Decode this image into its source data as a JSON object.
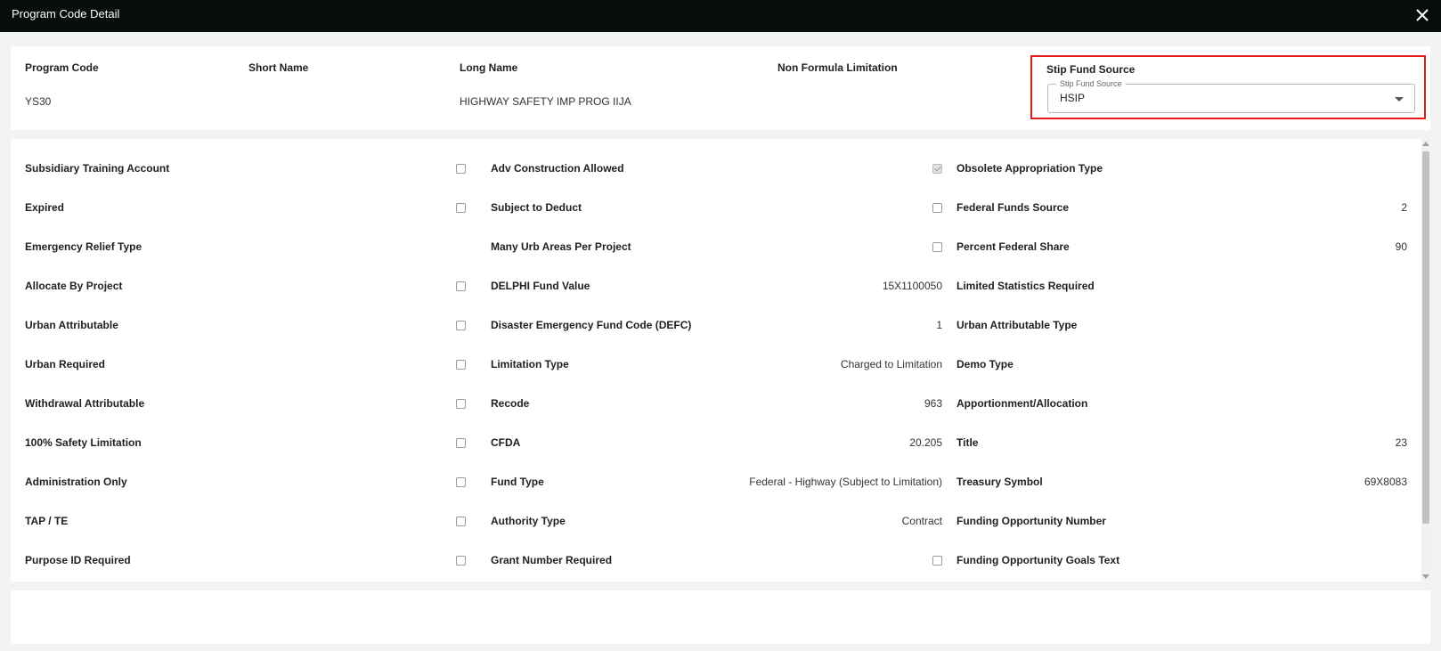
{
  "window": {
    "title": "Program Code Detail",
    "close_icon": "close-icon"
  },
  "header": {
    "program_code_label": "Program Code",
    "program_code_value": "YS30",
    "short_name_label": "Short Name",
    "short_name_value": "",
    "long_name_label": "Long Name",
    "long_name_value": "HIGHWAY SAFETY IMP PROG IIJA",
    "non_formula_label": "Non Formula Limitation",
    "non_formula_value": "",
    "stip_fund_source_label": "Stip Fund Source",
    "stip_fund_source_field_label": "Stip Fund Source",
    "stip_fund_source_value": "HSIP",
    "highlight_color": "#e31b1b"
  },
  "detail": {
    "rows": [
      {
        "c1": {
          "label": "Subsidiary Training Account",
          "checkbox": false
        },
        "c2": {
          "label": "Adv Construction Allowed",
          "checkbox": true
        },
        "c3": {
          "label": "Obsolete Appropriation Type",
          "value": ""
        }
      },
      {
        "c1": {
          "label": "Expired",
          "checkbox": false
        },
        "c2": {
          "label": "Subject to Deduct",
          "checkbox": false
        },
        "c3": {
          "label": "Federal Funds Source",
          "value": "2"
        }
      },
      {
        "c1": {
          "label": "Emergency Relief Type",
          "value": ""
        },
        "c2": {
          "label": "Many Urb Areas Per Project",
          "checkbox": false
        },
        "c3": {
          "label": "Percent Federal Share",
          "value": "90"
        }
      },
      {
        "c1": {
          "label": "Allocate By Project",
          "checkbox": false
        },
        "c2": {
          "label": "DELPHI Fund Value",
          "value": "15X1100050"
        },
        "c3": {
          "label": "Limited Statistics Required",
          "value": ""
        }
      },
      {
        "c1": {
          "label": "Urban Attributable",
          "checkbox": false
        },
        "c2": {
          "label": "Disaster Emergency Fund Code (DEFC)",
          "value": "1"
        },
        "c3": {
          "label": "Urban Attributable Type",
          "value": ""
        }
      },
      {
        "c1": {
          "label": "Urban Required",
          "checkbox": false
        },
        "c2": {
          "label": "Limitation Type",
          "value": "Charged to Limitation"
        },
        "c3": {
          "label": "Demo Type",
          "value": ""
        }
      },
      {
        "c1": {
          "label": "Withdrawal Attributable",
          "checkbox": false
        },
        "c2": {
          "label": "Recode",
          "value": "963"
        },
        "c3": {
          "label": "Apportionment/Allocation",
          "value": ""
        }
      },
      {
        "c1": {
          "label": "100% Safety Limitation",
          "checkbox": false
        },
        "c2": {
          "label": "CFDA",
          "value": "20.205"
        },
        "c3": {
          "label": "Title",
          "value": "23"
        }
      },
      {
        "c1": {
          "label": "Administration Only",
          "checkbox": false
        },
        "c2": {
          "label": "Fund Type",
          "value": "Federal - Highway (Subject to Limitation)"
        },
        "c3": {
          "label": "Treasury Symbol",
          "value": "69X8083"
        }
      },
      {
        "c1": {
          "label": "TAP / TE",
          "checkbox": false
        },
        "c2": {
          "label": "Authority Type",
          "value": "Contract"
        },
        "c3": {
          "label": "Funding Opportunity Number",
          "value": ""
        }
      },
      {
        "c1": {
          "label": "Purpose ID Required",
          "checkbox": false
        },
        "c2": {
          "label": "Grant Number Required",
          "checkbox": false
        },
        "c3": {
          "label": "Funding Opportunity Goals Text",
          "value": ""
        }
      }
    ]
  }
}
